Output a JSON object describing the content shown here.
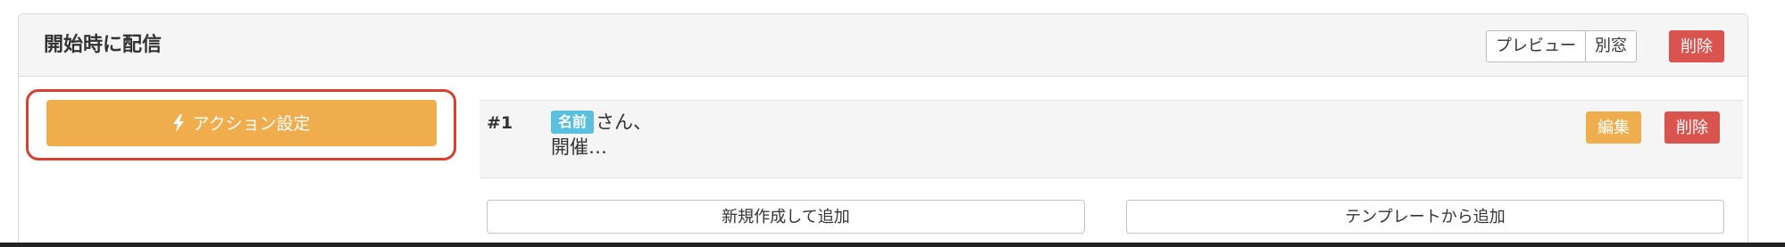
{
  "panel": {
    "title": "開始時に配信",
    "preview_label": "プレビュー",
    "new_window_label": "別窓",
    "delete_label": "削除"
  },
  "action": {
    "label": "アクション設定",
    "icon": "lightning-bolt-icon",
    "button_color": "#f0ad4e",
    "highlight_color": "#d9412f"
  },
  "message": {
    "number": "#1",
    "name_tag": "名前",
    "preview_line1": "さん、",
    "preview_line2": "開催…",
    "edit_label": "編集",
    "delete_label": "削除"
  },
  "add_buttons": {
    "new_label": "新規作成して追加",
    "template_label": "テンプレートから追加"
  }
}
